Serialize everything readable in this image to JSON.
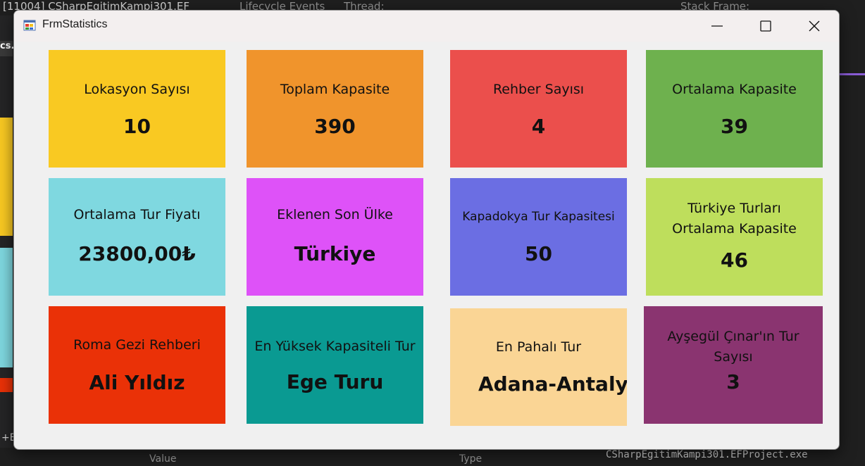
{
  "ide": {
    "top_left_text": "[11004] CSharpEgitimKampi301.EF",
    "lifecycle_label": "Lifecycle Events",
    "thread_label": "Thread:",
    "stack_frame_label": "Stack Frame:",
    "tab_fragment": "cs.",
    "bottom_left_text": "+E",
    "bottom_value_label": "Value",
    "bottom_type_label": "Type",
    "bottom_right_text": "CSharpEgitimKampi301.EFProject.exe"
  },
  "window": {
    "title": "FrmStatistics",
    "minimize_icon": "minimize-icon",
    "maximize_icon": "maximize-icon",
    "close_icon": "close-icon"
  },
  "tiles": [
    {
      "label": "Lokasyon Sayısı",
      "value": "10",
      "color": "#F9C922"
    },
    {
      "label": "Toplam Kapasite",
      "value": "390",
      "color": "#F0942C"
    },
    {
      "label": "Rehber Sayısı",
      "value": "4",
      "color": "#EB4F4C"
    },
    {
      "label": "Ortalama Kapasite",
      "value": "39",
      "color": "#6EB14E"
    },
    {
      "label": "Ortalama Tur Fiyatı",
      "value": "23800,00₺",
      "color": "#7FD8E0"
    },
    {
      "label": "Eklenen Son Ülke",
      "value": "Türkiye",
      "color": "#DE52F8"
    },
    {
      "label": "Kapadokya Tur Kapasitesi",
      "value": "50",
      "color": "#6B6EE3"
    },
    {
      "label_line1": "Türkiye Turları",
      "label_line2": "Ortalama Kapasite",
      "value": "46",
      "color": "#BEDE5C"
    },
    {
      "label": "Roma Gezi Rehberi",
      "value": "Ali Yıldız",
      "color": "#EA3107"
    },
    {
      "label": "En Yüksek Kapasiteli Tur",
      "value": "Ege Turu",
      "color": "#0A9A92"
    },
    {
      "label": "En Pahalı Tur",
      "value": "Adana-Antaly-",
      "color": "#FAD595"
    },
    {
      "label_line1": "Ayşegül Çınar'ın Tur",
      "label_line2": "Sayısı",
      "value": "3",
      "color": "#8A3470"
    }
  ]
}
